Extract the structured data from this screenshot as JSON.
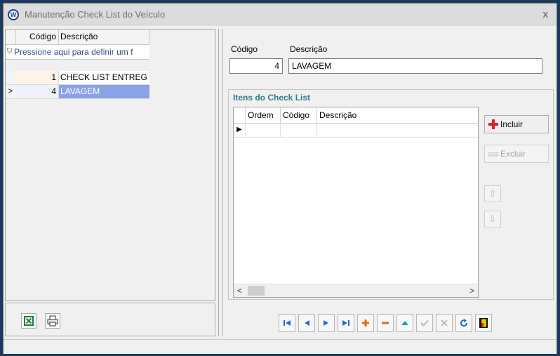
{
  "window": {
    "title": "Manutenção Check List do Veículo",
    "close_label": "x",
    "logo_text": "W"
  },
  "left_grid": {
    "columns": [
      "Código",
      "Descrição"
    ],
    "filter_text": "Pressione aqui para definir um f",
    "rows": [
      {
        "codigo": "1",
        "descricao": "CHECK LIST ENTREG",
        "indicator": ""
      },
      {
        "codigo": "4",
        "descricao": "LAVAGEM",
        "indicator": ">"
      }
    ]
  },
  "form": {
    "codigo_label": "Código",
    "codigo_value": "4",
    "descricao_label": "Descrição",
    "descricao_value": "LAVAGEM"
  },
  "items": {
    "title": "Itens do Check List",
    "columns": [
      "Ordem",
      "Código",
      "Descrição"
    ],
    "row_indicator": "▶",
    "scroll_left": "<",
    "scroll_right": ">"
  },
  "buttons": {
    "incluir": "Incluir",
    "excluir": "Excluir",
    "up": "⇧",
    "down": "⇩"
  },
  "colors": {
    "accent_title": "#2e7d8a",
    "selection": "#8aa3e6",
    "add_red": "#e02020"
  }
}
